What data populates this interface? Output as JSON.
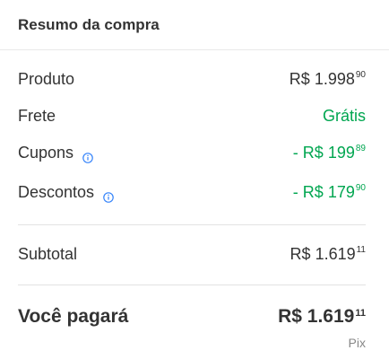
{
  "header": {
    "title": "Resumo da compra"
  },
  "lines": {
    "produto": {
      "label": "Produto",
      "currency": "R$",
      "amount": "1.998",
      "cents": "90"
    },
    "frete": {
      "label": "Frete",
      "value": "Grátis"
    },
    "cupons": {
      "label": "Cupons",
      "prefix": "- R$",
      "amount": "199",
      "cents": "89"
    },
    "descontos": {
      "label": "Descontos",
      "prefix": "- R$",
      "amount": "179",
      "cents": "90"
    },
    "subtotal": {
      "label": "Subtotal",
      "currency": "R$",
      "amount": "1.619",
      "cents": "11"
    }
  },
  "total": {
    "label": "Você pagará",
    "currency": "R$",
    "amount": "1.619",
    "cents": "11",
    "method": "Pix"
  },
  "colors": {
    "discount": "#00a650",
    "info_icon": "#3483fa"
  }
}
